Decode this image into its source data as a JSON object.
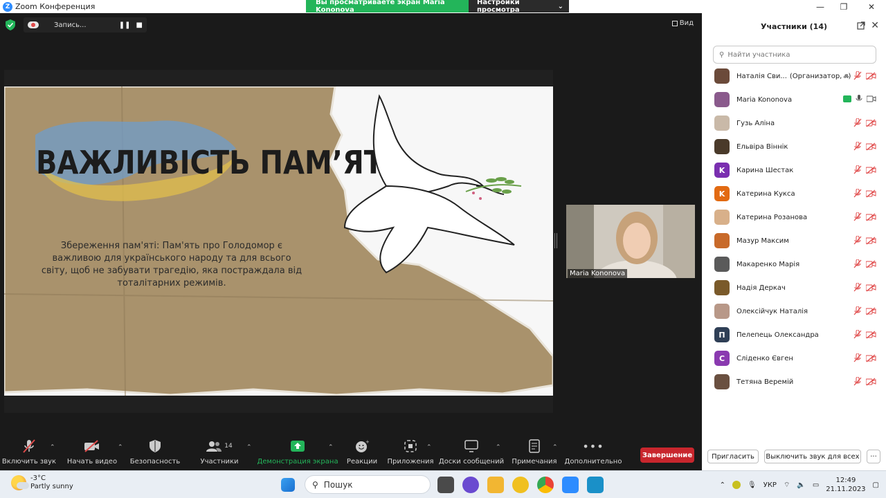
{
  "window": {
    "title": "Zoom Конференция",
    "share_banner": "Вы просматриваете экран Maria Kononova",
    "view_settings": "Настройки просмотра"
  },
  "recording": {
    "label": "Запись...",
    "pause_icon": "pause-icon",
    "stop_icon": "stop-icon"
  },
  "view_button": "Вид",
  "slide": {
    "title": "ВАЖЛИВІСТЬ ПАМ’ЯТІ",
    "body": "Збереження пам'яті: Пам'ять про Голодомор є важливою для українського народу та для всього світу, щоб не забувати трагедію, яка постраждала від тоталітарних режимів."
  },
  "video_tile": {
    "name": "Maria Kononova"
  },
  "toolbar": {
    "mute": "Включить звук",
    "video": "Начать видео",
    "security": "Безопасность",
    "participants": "Участники",
    "participants_count": "14",
    "share": "Демонстрация экрана",
    "reactions": "Реакции",
    "apps": "Приложения",
    "whiteboards": "Доски сообщений",
    "notes": "Примечания",
    "more": "Дополнительно",
    "end": "Завершение"
  },
  "panel": {
    "title": "Участники (14)",
    "search_placeholder": "Найти участника",
    "invite": "Пригласить",
    "unmute_all": "Выключить звук для всех",
    "participants": [
      {
        "name": "Наталія Сви...",
        "role": "(Организатор, я)",
        "avatar_color": "#6b4a3a",
        "initial": ""
      },
      {
        "name": "Maria Kononova",
        "role": "",
        "avatar_color": "#8a5a8c",
        "initial": ""
      },
      {
        "name": "Гузь Аліна",
        "role": "",
        "avatar_color": "#c9b9a8",
        "initial": ""
      },
      {
        "name": "Ельвіра Віннік",
        "role": "",
        "avatar_color": "#4a3a2a",
        "initial": ""
      },
      {
        "name": "Карина Шестак",
        "role": "",
        "avatar_color": "#7a2fb0",
        "initial": "K"
      },
      {
        "name": "Катерина Кукса",
        "role": "",
        "avatar_color": "#e26a12",
        "initial": "K"
      },
      {
        "name": "Катерина Розанова",
        "role": "",
        "avatar_color": "#d8b08a",
        "initial": ""
      },
      {
        "name": "Мазур Максим",
        "role": "",
        "avatar_color": "#c86a2a",
        "initial": ""
      },
      {
        "name": "Макаренко Марія",
        "role": "",
        "avatar_color": "#5a5a5a",
        "initial": ""
      },
      {
        "name": "Надія Деркач",
        "role": "",
        "avatar_color": "#7a5a2a",
        "initial": ""
      },
      {
        "name": "Олексійчук Наталія",
        "role": "",
        "avatar_color": "#b89888",
        "initial": ""
      },
      {
        "name": "Пелепець Олександра",
        "role": "",
        "avatar_color": "#2f3f56",
        "initial": "П"
      },
      {
        "name": "Сліденко Євген",
        "role": "",
        "avatar_color": "#8a3ab0",
        "initial": "С"
      },
      {
        "name": "Тетяна Веремій",
        "role": "",
        "avatar_color": "#6a5040",
        "initial": ""
      }
    ]
  },
  "taskbar": {
    "temperature": "-3°C",
    "weather": "Partly sunny",
    "search": "Пошук",
    "language": "УКР",
    "time": "12:49",
    "date": "21.11.2023"
  }
}
